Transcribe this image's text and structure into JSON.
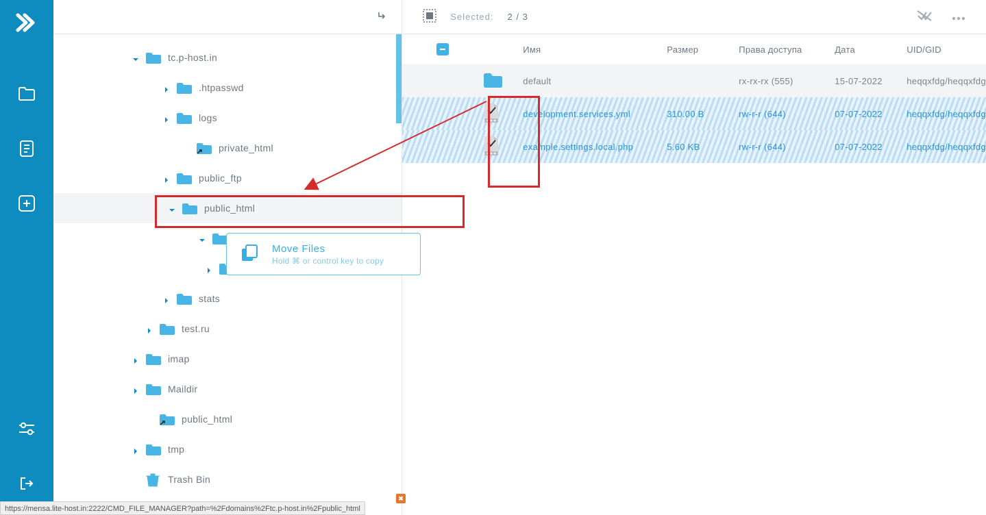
{
  "header": {
    "selected_label": "Selected:",
    "selected_count": "2 / 3"
  },
  "columns": {
    "name": "Имя",
    "size": "Размер",
    "perm": "Права доступа",
    "date": "Дата",
    "uid": "UID/GID"
  },
  "tree": [
    {
      "label": "tc.p-host.in",
      "indent": 115,
      "expanded": "down",
      "hasFolder": true
    },
    {
      "label": ".htpasswd",
      "indent": 160,
      "expanded": "right",
      "hasFolder": true
    },
    {
      "label": "logs",
      "indent": 160,
      "expanded": "right",
      "hasFolder": true
    },
    {
      "label": "private_html",
      "indent": 189,
      "noChev": true,
      "hasFolder": true,
      "link": true
    },
    {
      "label": "public_ftp",
      "indent": 160,
      "expanded": "right",
      "hasFolder": true
    },
    {
      "label": "public_html",
      "indent": 168,
      "expanded": "down",
      "hasFolder": true,
      "selected": true
    },
    {
      "label": "",
      "indent": 212,
      "expanded": "down",
      "hasFolder": true,
      "folderOnly": true
    },
    {
      "label": "",
      "indent": 222,
      "expanded": "right",
      "hasFolder": true,
      "folderOnly": true
    },
    {
      "label": "stats",
      "indent": 160,
      "expanded": "right",
      "hasFolder": true
    },
    {
      "label": "test.ru",
      "indent": 135,
      "expanded": "right",
      "hasFolder": true
    },
    {
      "label": "imap",
      "indent": 115,
      "expanded": "right",
      "hasFolder": true
    },
    {
      "label": "Maildir",
      "indent": 115,
      "expanded": "right",
      "hasFolder": true
    },
    {
      "label": "public_html",
      "indent": 135,
      "noChev": true,
      "hasFolder": true,
      "link": true
    },
    {
      "label": "tmp",
      "indent": 115,
      "expanded": "right",
      "hasFolder": true
    },
    {
      "label": "Trash Bin",
      "indent": 115,
      "noChev": true,
      "hasFolder": true,
      "trash": true
    }
  ],
  "files": [
    {
      "kind": "dir",
      "name": "default",
      "size": "",
      "perm": "rx-rx-rx (555)",
      "date": "15-07-2022",
      "uid": "heqqxfdg/heqqxfdg",
      "selected": false
    },
    {
      "kind": "file",
      "name": "development.services.yml",
      "size": "310.00 B",
      "perm": "rw-r-r (644)",
      "date": "07-07-2022",
      "uid": "heqqxfdg/heqqxfdg",
      "selected": true
    },
    {
      "kind": "file",
      "name": "example.settings.local.php",
      "size": "5.60 KB",
      "perm": "rw-r-r (644)",
      "date": "07-07-2022",
      "uid": "heqqxfdg/heqqxfdg",
      "selected": true
    }
  ],
  "tooltip": {
    "title": "Move Files",
    "subtitle": "Hold ⌘ or control key to copy"
  },
  "status_url": "https://mensa.lite-host.in:2222/CMD_FILE_MANAGER?path=%2Fdomains%2Ftc.p-host.in%2Fpublic_html"
}
